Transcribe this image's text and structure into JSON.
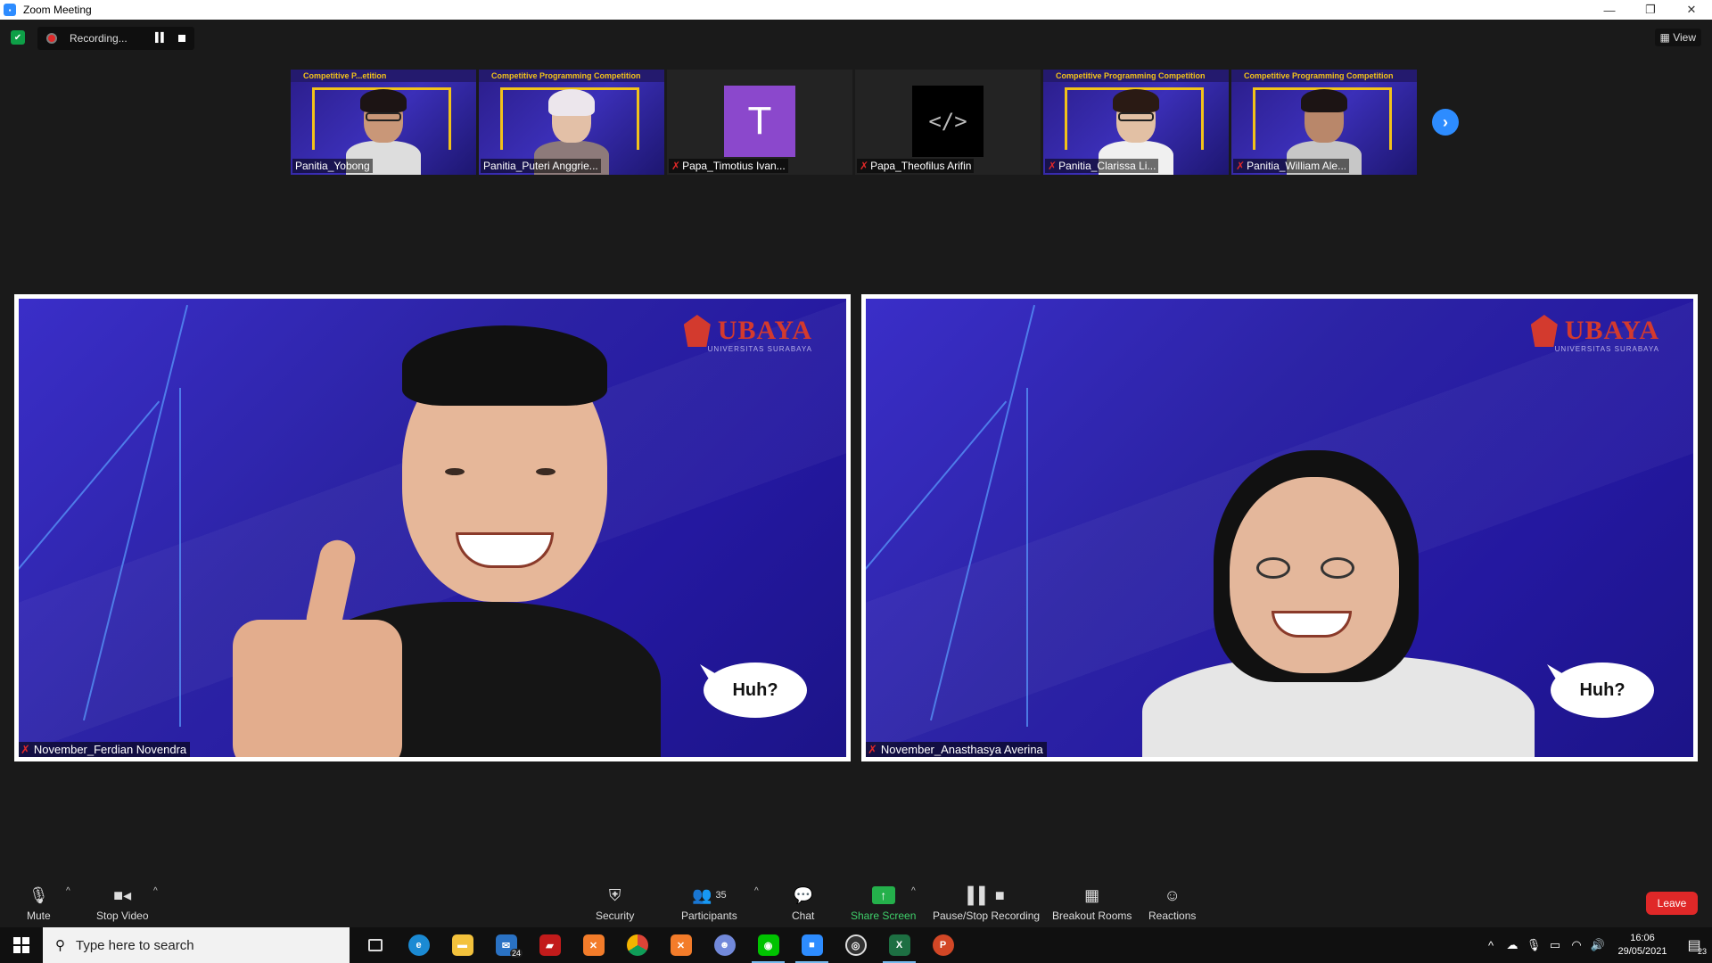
{
  "window": {
    "title": "Zoom Meeting",
    "min": "—",
    "restore": "❐",
    "close": "✕"
  },
  "recording": {
    "label": "Recording..."
  },
  "view_label": "View",
  "thumbnails": [
    {
      "name": "Panitia_Yobong",
      "kind": "camera",
      "banner": "Competitive P...etition"
    },
    {
      "name": "Panitia_Puteri Anggrie...",
      "kind": "camera",
      "banner": "Competitive Programming Competition"
    },
    {
      "name": "Papa_Timotius Ivan...",
      "kind": "avatar",
      "avatar": "T"
    },
    {
      "name": "Papa_Theofilus Arifin",
      "kind": "avatar",
      "avatar": "</>"
    },
    {
      "name": "Panitia_Clarissa Li...",
      "kind": "camera",
      "banner": "Competitive Programming Competition"
    },
    {
      "name": "Panitia_William Ale...",
      "kind": "camera",
      "banner": "Competitive Programming Competition"
    }
  ],
  "tiles": [
    {
      "name": "November_Ferdian Novendra",
      "logo": "UBAYA",
      "logo_sub": "UNIVERSITAS SURABAYA",
      "bubble": "Huh?"
    },
    {
      "name": "November_Anasthasya Averina",
      "logo": "UBAYA",
      "logo_sub": "UNIVERSITAS SURABAYA",
      "bubble": "Huh?"
    }
  ],
  "toolbar": {
    "mute": "Mute",
    "stop_video": "Stop Video",
    "security": "Security",
    "participants": "Participants",
    "participants_count": "35",
    "chat": "Chat",
    "share_screen": "Share Screen",
    "pause_stop_recording": "Pause/Stop Recording",
    "breakout_rooms": "Breakout Rooms",
    "reactions": "Reactions",
    "leave": "Leave"
  },
  "taskbar": {
    "search_placeholder": "Type here to search",
    "mail_badge": "24",
    "time": "16:06",
    "date": "29/05/2021",
    "notifications": "23"
  },
  "colors": {
    "accent": "#2d8cff",
    "leave": "#e02828",
    "share": "#24b04b"
  }
}
